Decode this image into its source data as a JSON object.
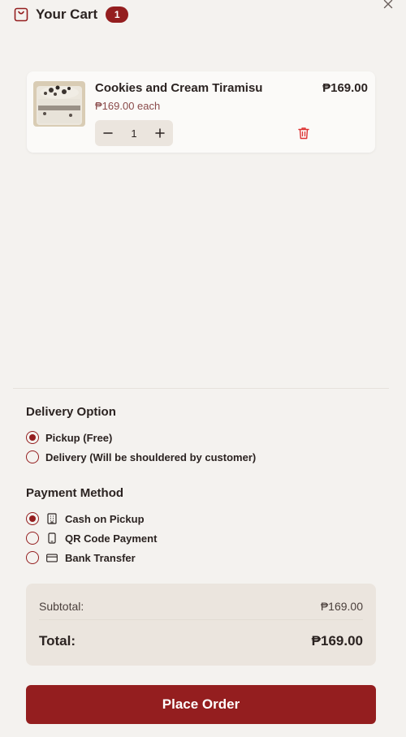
{
  "header": {
    "title": "Your Cart",
    "count": "1",
    "icon": "shopping-bag-icon",
    "close_icon": "close-icon"
  },
  "cart": {
    "items": [
      {
        "name": "Cookies and Cream Tiramisu",
        "each_price": "₱169.00 each",
        "line_total": "₱169.00",
        "quantity": "1",
        "decrement_icon": "minus-icon",
        "increment_icon": "plus-icon",
        "remove_icon": "trash-icon"
      }
    ]
  },
  "delivery": {
    "title": "Delivery Option",
    "options": [
      {
        "label": "Pickup (Free)",
        "selected": true
      },
      {
        "label": "Delivery (Will be shouldered by customer)",
        "selected": false
      }
    ]
  },
  "payment": {
    "title": "Payment Method",
    "options": [
      {
        "label": "Cash on Pickup",
        "icon": "building-icon",
        "selected": true
      },
      {
        "label": "QR Code Payment",
        "icon": "phone-icon",
        "selected": false
      },
      {
        "label": "Bank Transfer",
        "icon": "credit-card-icon",
        "selected": false
      }
    ]
  },
  "summary": {
    "subtotal_label": "Subtotal:",
    "subtotal_value": "₱169.00",
    "total_label": "Total:",
    "total_value": "₱169.00"
  },
  "actions": {
    "place_order_label": "Place Order"
  },
  "colors": {
    "accent": "#941e1f",
    "background": "#f4f2ef",
    "card": "#fbfaf8",
    "summary_bg": "#ebe5de",
    "muted_price": "#8a4a4a"
  }
}
